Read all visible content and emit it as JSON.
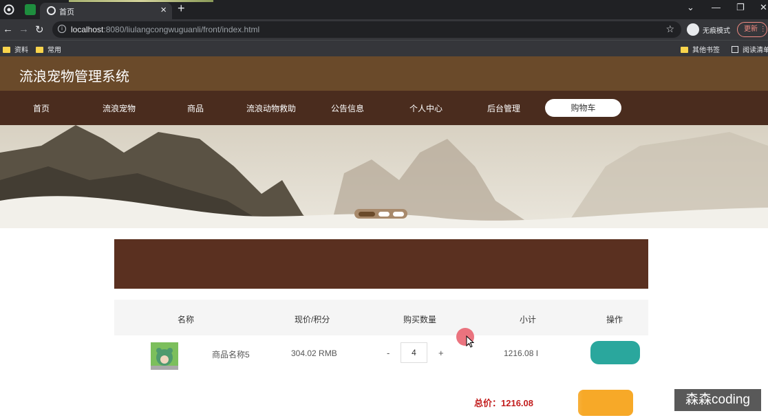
{
  "browser": {
    "tab_title": "首页",
    "url_host": "localhost",
    "url_rest": ":8080/liulangcongwuguanli/front/index.html",
    "incognito_label": "无痕模式",
    "update_label": "更新",
    "bookmarks": [
      "资料",
      "常用"
    ],
    "bookmarks_right": [
      "其他书签",
      "阅读清单"
    ]
  },
  "site": {
    "title": "流浪宠物管理系统",
    "nav": [
      "首页",
      "流浪宠物",
      "商品",
      "流浪动物救助",
      "公告信息",
      "个人中心",
      "后台管理"
    ],
    "nav_active": "购物车"
  },
  "cart": {
    "headers": {
      "name": "名称",
      "price": "现价/积分",
      "quantity": "购买数量",
      "subtotal": "小计",
      "action": "操作"
    },
    "items": [
      {
        "name": "商品名称5",
        "price": "304.02 RMB",
        "quantity": "4",
        "subtotal": "1216.08 I"
      }
    ],
    "minus": "-",
    "plus": "+",
    "total_text": "总价：1216.08"
  },
  "watermark": "森森coding",
  "colors": {
    "header_bg": "#6a4a2a",
    "nav_bg": "#4a2c1e",
    "accent_green": "#2aa79d",
    "accent_orange": "#f7a928",
    "price_red": "#c21d1d"
  }
}
